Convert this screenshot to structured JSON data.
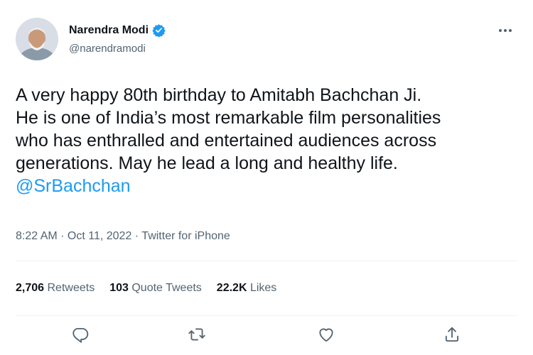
{
  "author": {
    "display_name": "Narendra Modi",
    "handle": "@narendramodi",
    "verified_icon": "verified-badge-icon"
  },
  "tweet": {
    "lines": [
      "A very happy 80th birthday to Amitabh Bachchan Ji.",
      "He is one of India’s most remarkable film personalities",
      "who has enthralled and entertained audiences across",
      "generations. May he lead a long and healthy life."
    ],
    "mention": "@SrBachchan",
    "time": "8:22 AM · Oct 11, 2022",
    "separator": " · ",
    "source": "Twitter for iPhone"
  },
  "stats": {
    "retweets_count": "2,706",
    "retweets_label": "Retweets",
    "quotes_count": "103",
    "quotes_label": "Quote Tweets",
    "likes_count": "22.2K",
    "likes_label": "Likes"
  },
  "actions": {
    "icons": [
      "reply-icon",
      "retweet-icon",
      "like-icon",
      "share-icon"
    ]
  },
  "colors": {
    "accent": "#1d9bf0",
    "text": "#0f1419",
    "secondary": "#536471",
    "divider": "#eff3f4"
  }
}
